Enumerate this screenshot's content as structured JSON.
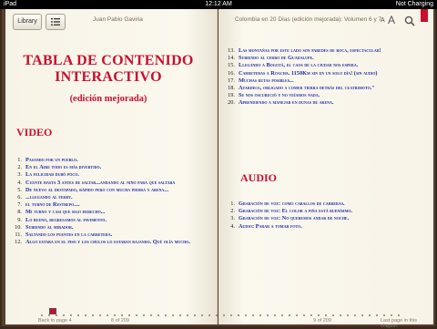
{
  "status": {
    "device": "iPad",
    "time": "12:12 AM",
    "battery": "Not Charging"
  },
  "toolbar": {
    "library_label": "Library",
    "author": "Juan Pablo Gaviria",
    "book_title": "Colombia en 20 Días (edición mejorada): Volumen 6 y 7",
    "font_small": "A",
    "font_large": "A"
  },
  "left_page": {
    "title_line1": "TABLA DE CONTENIDO",
    "title_line2": "INTERACTIVO",
    "subtitle": "(edición mejorada)",
    "section_video": "VIDEO",
    "items": [
      {
        "n": "1.",
        "t": "Pasando por un pueblo."
      },
      {
        "n": "2.",
        "t": "En el Aire todo es más divertido."
      },
      {
        "n": "3.",
        "t": "La felicidad dubó poco."
      },
      {
        "n": "4.",
        "t": "Cuente hasta 3 antes de saltar...andando al niño para que saltara"
      },
      {
        "n": "5.",
        "t": "De nuevo al destapado, rápido pero con mucha piedra y arena..."
      },
      {
        "n": "6.",
        "t": "...llegando al ferry."
      },
      {
        "n": "7.",
        "t": "el turno de Restrepo...."
      },
      {
        "n": "8.",
        "t": "Mi turno y casi que sigo derecho..."
      },
      {
        "n": "9.",
        "t": "Lo bueno, regresamos al pavimento."
      },
      {
        "n": "10.",
        "t": "Subiendo al mirador."
      },
      {
        "n": "11.",
        "t": "Saltando los puentes en la carretera."
      },
      {
        "n": "12.",
        "t": "Algo estaba en el piso y los chulos lo estaban bajando. Qué olía mucho."
      }
    ],
    "footer_left": "Back to page 4",
    "footer_page": "8 of 209"
  },
  "right_page": {
    "items": [
      {
        "n": "13.",
        "t": "Las montañas por este lado son paredes de roca, espectacular!"
      },
      {
        "n": "14.",
        "t": "Subiendo al cerro de Guadalupe."
      },
      {
        "n": "15.",
        "t": "Llegando a Bogotá, el caos de la ciudad nos espera."
      },
      {
        "n": "16.",
        "t": "Carreteras a Roacha. 1150Km sin en un solo día! (sin audio)"
      },
      {
        "n": "17.",
        "t": "Muchas rutas posibles..."
      },
      {
        "n": "18.",
        "t": "Atardece, obligado a comer tierra detrás del cuatrimoto.\""
      },
      {
        "n": "19.",
        "t": "Se nos oscureció y no veíamos nada."
      },
      {
        "n": "20.",
        "t": "Aprendiendo a manejar en dunas de arena."
      }
    ],
    "section_audio": "AUDIO",
    "audio_items": [
      {
        "n": "1.",
        "t": "Grabación de voz: como caballos de carreras."
      },
      {
        "n": "2.",
        "t": "Grabación de voz: El color a piña está buenísimo."
      },
      {
        "n": "3.",
        "t": "Grabación de voz: No queremos andar de noche."
      },
      {
        "n": "4.",
        "t": "Audio: Parar a tomar foto."
      }
    ],
    "footer_page": "9 of 209",
    "footer_right": "Last page in this chapter"
  },
  "colors": {
    "heading_red": "#c8102e",
    "link_blue": "#1f2fa8"
  },
  "icons": {
    "toc": "list-icon",
    "bookmark": "bookmark-icon"
  }
}
